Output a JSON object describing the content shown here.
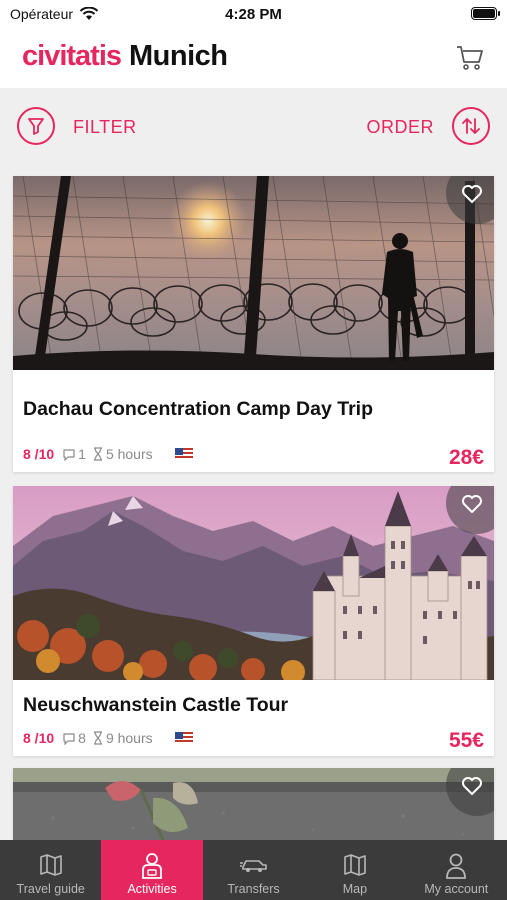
{
  "status_bar": {
    "carrier": "Opérateur",
    "time": "4:28 PM"
  },
  "header": {
    "logo": "civitatis",
    "city": "Munich"
  },
  "toolbar": {
    "filter_label": "FILTER",
    "order_label": "ORDER"
  },
  "activities": [
    {
      "title": "Dachau Concentration Camp Day Trip",
      "rating": "8 /10",
      "reviews": "1",
      "duration": "5 hours",
      "price": "28€",
      "language_flag": "us-flag"
    },
    {
      "title": "Neuschwanstein Castle Tour",
      "rating": "8 /10",
      "reviews": "8",
      "duration": "9 hours",
      "price": "55€",
      "language_flag": "us-flag"
    }
  ],
  "tabs": [
    {
      "label": "Travel guide",
      "icon": "map-book-icon"
    },
    {
      "label": "Activities",
      "icon": "person-icon"
    },
    {
      "label": "Transfers",
      "icon": "car-icon"
    },
    {
      "label": "Map",
      "icon": "map-icon"
    },
    {
      "label": "My account",
      "icon": "account-icon"
    }
  ],
  "colors": {
    "accent": "#e6265e",
    "tabbar": "#3b3b3b",
    "background": "#efefef"
  }
}
